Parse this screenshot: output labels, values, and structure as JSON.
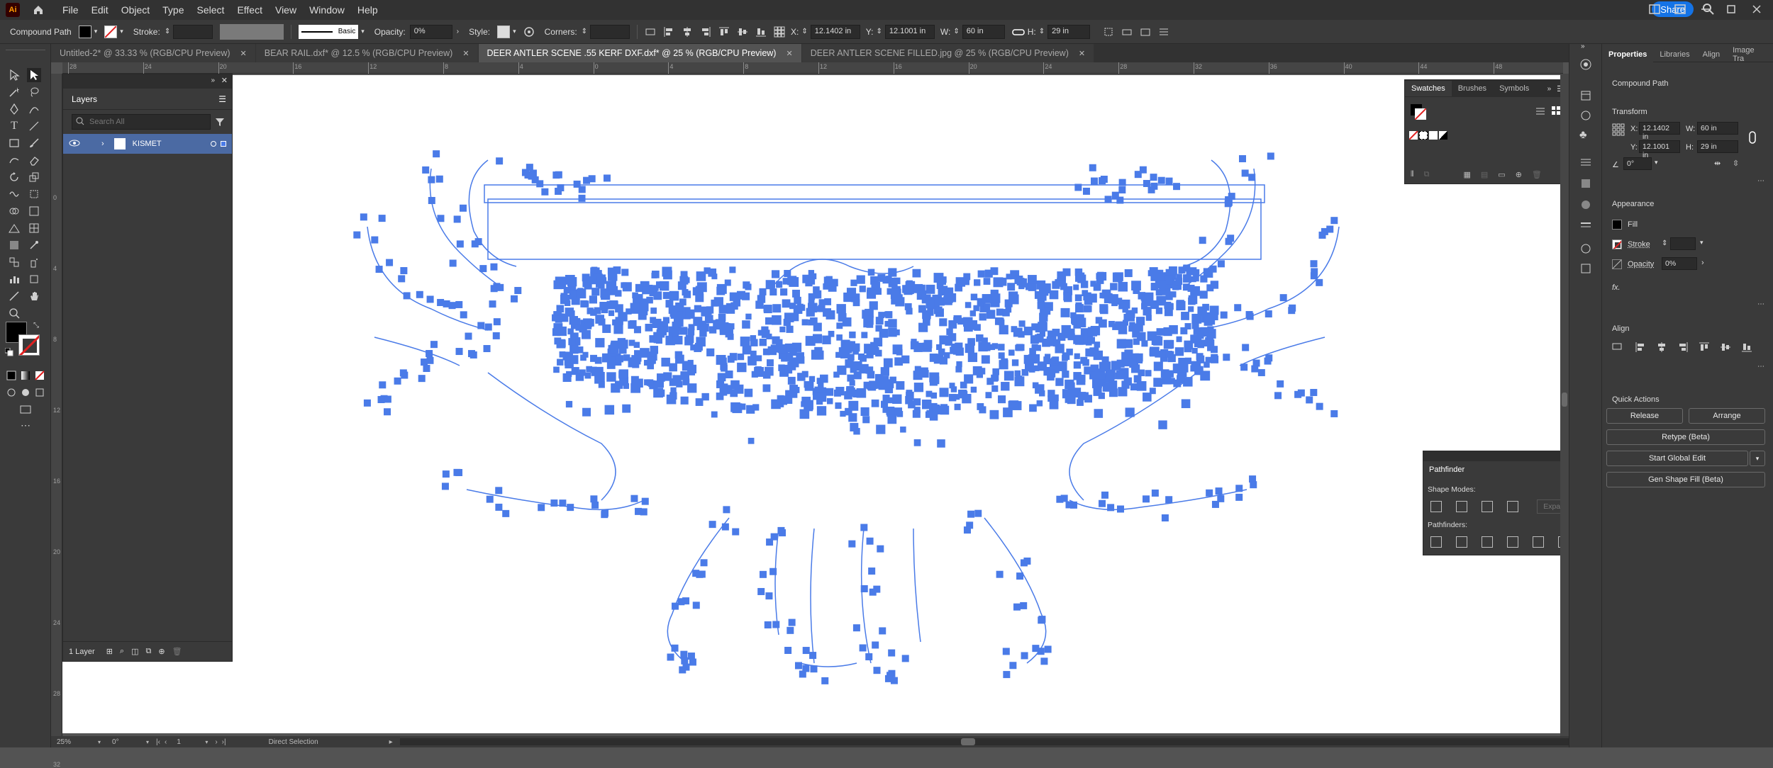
{
  "app": {
    "logo_text": "Ai",
    "menus": [
      "File",
      "Edit",
      "Object",
      "Type",
      "Select",
      "Effect",
      "View",
      "Window",
      "Help"
    ],
    "share_label": "Share"
  },
  "control_bar": {
    "selection_type": "Compound Path",
    "stroke_label": "Stroke:",
    "basic_label": "Basic",
    "opacity_label": "Opacity:",
    "opacity_value": "0%",
    "style_label": "Style:",
    "corners_label": "Corners:",
    "x_label": "X:",
    "x_value": "12.1402 in",
    "y_label": "Y:",
    "y_value": "12.1001 in",
    "w_label": "W:",
    "w_value": "60 in",
    "h_label": "H:",
    "h_value": "29 in"
  },
  "tabs": [
    {
      "label": "Untitled-2* @ 33.33 % (RGB/CPU Preview)"
    },
    {
      "label": "BEAR RAIL.dxf* @ 12.5 % (RGB/CPU Preview)"
    },
    {
      "label": "DEER ANTLER SCENE .55 KERF DXF.dxf* @ 25 % (RGB/CPU Preview)"
    },
    {
      "label": "DEER ANTLER SCENE FILLED.jpg @ 25 % (RGB/CPU Preview)"
    }
  ],
  "ruler_top_ticks": [
    "28",
    "24",
    "20",
    "16",
    "12",
    "8",
    "4",
    "0",
    "4",
    "8",
    "12",
    "16",
    "20",
    "24",
    "28",
    "32",
    "36",
    "40",
    "44",
    "48"
  ],
  "ruler_left_ticks": [
    "0",
    "4",
    "8",
    "12",
    "16",
    "20",
    "24",
    "28",
    "32"
  ],
  "layers": {
    "title": "Layers",
    "search_placeholder": "Search All",
    "layer_name": "KISMET",
    "footer_count": "1 Layer"
  },
  "swatches_panel": {
    "tabs": [
      "Swatches",
      "Brushes",
      "Symbols"
    ]
  },
  "pathfinder": {
    "title": "Pathfinder",
    "shape_modes_label": "Shape Modes:",
    "expand_label": "Expand",
    "pathfinders_label": "Pathfinders:"
  },
  "properties": {
    "tabs": [
      "Properties",
      "Libraries",
      "Align",
      "Image Tra"
    ],
    "selection_type": "Compound Path",
    "transform_title": "Transform",
    "x_label": "X:",
    "x_value": "12.1402 in",
    "y_label": "Y:",
    "y_value": "12.1001 in",
    "w_label": "W:",
    "w_value": "60 in",
    "h_label": "H:",
    "h_value": "29 in",
    "rotate_value": "0°",
    "appearance_title": "Appearance",
    "fill_label": "Fill",
    "stroke_label": "Stroke",
    "opacity_label": "Opacity",
    "opacity_value": "0%",
    "fx_label": "fx.",
    "align_title": "Align",
    "quick_actions_title": "Quick Actions",
    "release_label": "Release",
    "arrange_label": "Arrange",
    "retype_label": "Retype (Beta)",
    "global_edit_label": "Start Global Edit",
    "gen_shape_label": "Gen Shape Fill (Beta)"
  },
  "status_bar": {
    "zoom": "25%",
    "rotation": "0°",
    "artboard": "1",
    "tool": "Direct Selection"
  },
  "colors": {
    "accent": "#1473e6",
    "selection_blue": "#4a7be8",
    "layer_row": "#4b6aa3"
  }
}
